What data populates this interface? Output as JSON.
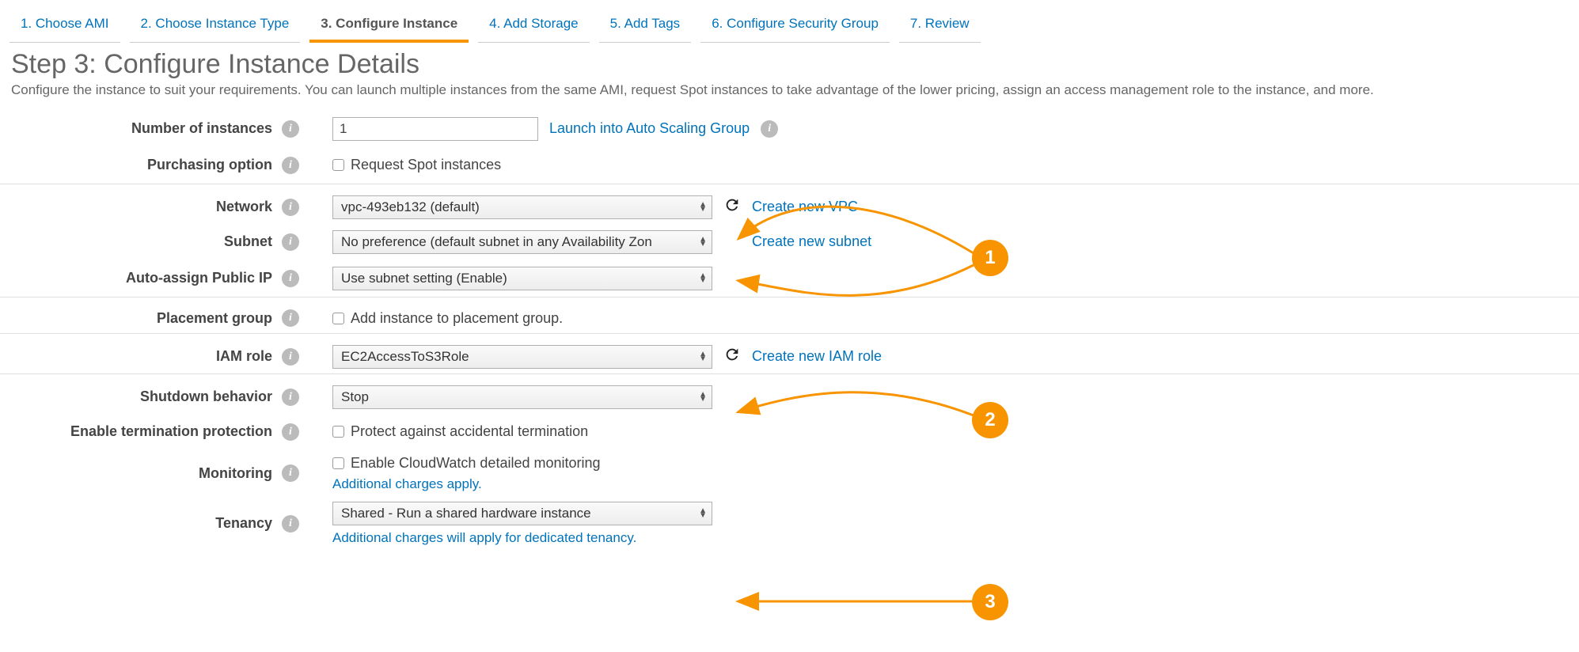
{
  "wizard": {
    "steps": [
      {
        "label": "1. Choose AMI"
      },
      {
        "label": "2. Choose Instance Type"
      },
      {
        "label": "3. Configure Instance"
      },
      {
        "label": "4. Add Storage"
      },
      {
        "label": "5. Add Tags"
      },
      {
        "label": "6. Configure Security Group"
      },
      {
        "label": "7. Review"
      }
    ],
    "active_index": 2
  },
  "header": {
    "title": "Step 3: Configure Instance Details",
    "description": "Configure the instance to suit your requirements. You can launch multiple instances from the same AMI, request Spot instances to take advantage of the lower pricing, assign an access management role to the instance, and more."
  },
  "form": {
    "number_of_instances": {
      "label": "Number of instances",
      "value": "1",
      "link": "Launch into Auto Scaling Group"
    },
    "purchasing_option": {
      "label": "Purchasing option",
      "checkbox_label": "Request Spot instances"
    },
    "network": {
      "label": "Network",
      "value": "vpc-493eb132 (default)",
      "link": "Create new VPC"
    },
    "subnet": {
      "label": "Subnet",
      "value": "No preference (default subnet in any Availability Zon",
      "link": "Create new subnet"
    },
    "auto_assign_ip": {
      "label": "Auto-assign Public IP",
      "value": "Use subnet setting (Enable)"
    },
    "placement_group": {
      "label": "Placement group",
      "checkbox_label": "Add instance to placement group."
    },
    "iam_role": {
      "label": "IAM role",
      "value": "EC2AccessToS3Role",
      "link": "Create new IAM role"
    },
    "shutdown_behavior": {
      "label": "Shutdown behavior",
      "value": "Stop"
    },
    "termination_protection": {
      "label": "Enable termination protection",
      "checkbox_label": "Protect against accidental termination"
    },
    "monitoring": {
      "label": "Monitoring",
      "checkbox_label": "Enable CloudWatch detailed monitoring",
      "note": "Additional charges apply."
    },
    "tenancy": {
      "label": "Tenancy",
      "value": "Shared - Run a shared hardware instance",
      "note": "Additional charges will apply for dedicated tenancy."
    }
  },
  "callouts": {
    "c1": "1",
    "c2": "2",
    "c3": "3"
  }
}
